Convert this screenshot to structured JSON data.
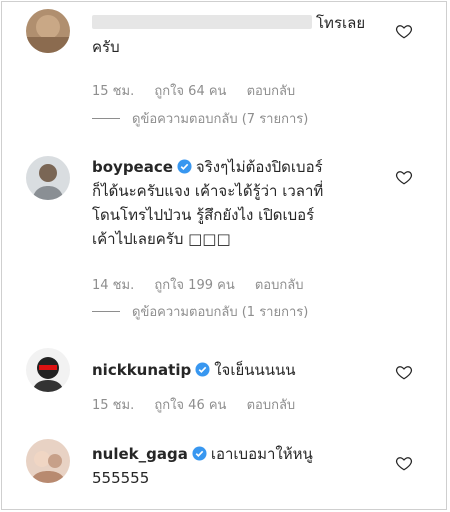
{
  "comments": [
    {
      "username": "",
      "text": "โทรเลย\nครับ",
      "time": "15 ชม.",
      "likes": "ถูกใจ 64 คน",
      "reply": "ตอบกลับ",
      "view_replies": "ดูข้อความตอบกลับ (7 รายการ)"
    },
    {
      "username": "boypeace",
      "text": "จริงๆไม่ต้องปิดเบอร์\nก็ได้นะครับแจง เค้าจะได้รู้ว่า เวลาที่\nโดนโทรไปป่วน รู้สึกยังไง เปิดเบอร์\nเค้าไปเลยครับ □□□",
      "time": "14 ชม.",
      "likes": "ถูกใจ 199 คน",
      "reply": "ตอบกลับ",
      "view_replies": "ดูข้อความตอบกลับ (1 รายการ)"
    },
    {
      "username": "nickkunatip",
      "text": "ใจเย็นนนนน",
      "time": "15 ชม.",
      "likes": "ถูกใจ 46 คน",
      "reply": "ตอบกลับ"
    },
    {
      "username": "nulek_gaga",
      "text": "เอาเบอมาให้หนู\n555555"
    }
  ],
  "colors": {
    "verified": "#3897f0",
    "meta": "#8e8e8e",
    "text": "#262626"
  },
  "icons": {
    "like": "heart-outline-icon",
    "verified": "verified-badge-icon"
  }
}
